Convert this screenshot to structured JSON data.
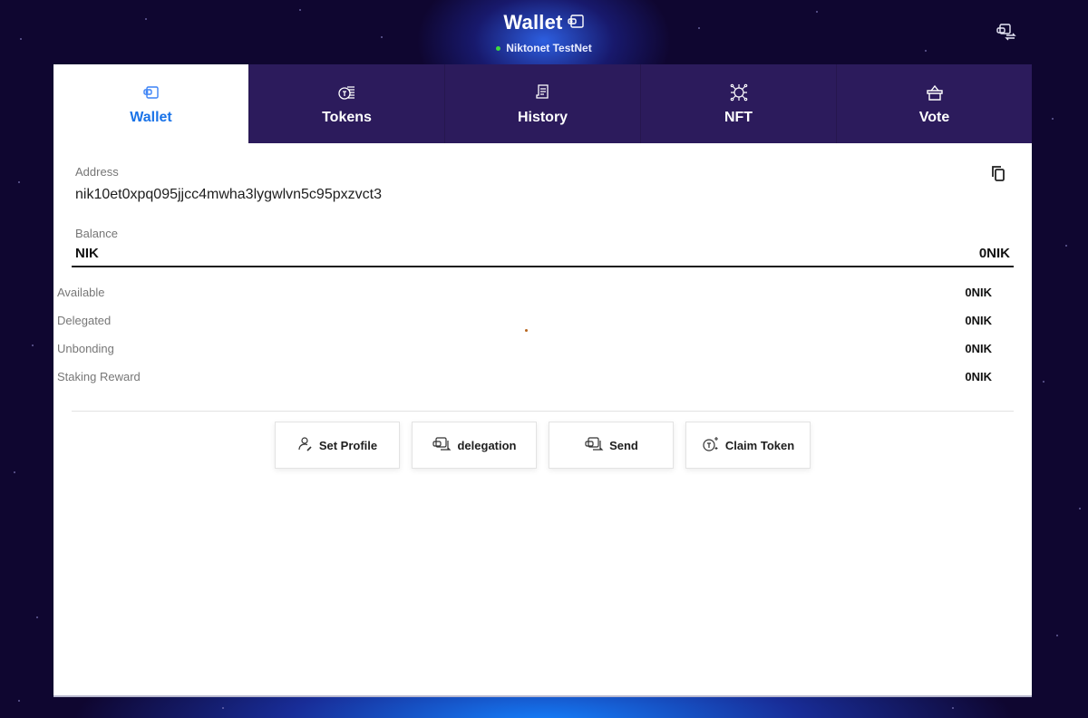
{
  "header": {
    "title": "Wallet",
    "title_icon": "wallet-icon",
    "network": "Niktonet TestNet",
    "network_status_color": "#3ddc3d",
    "switch_icon": "wallet-switch-icon"
  },
  "tabs": [
    {
      "label": "Wallet",
      "icon": "wallet-icon",
      "active": true
    },
    {
      "label": "Tokens",
      "icon": "tokens-icon",
      "active": false
    },
    {
      "label": "History",
      "icon": "history-icon",
      "active": false
    },
    {
      "label": "NFT",
      "icon": "nft-icon",
      "active": false
    },
    {
      "label": "Vote",
      "icon": "vote-icon",
      "active": false
    }
  ],
  "address": {
    "label": "Address",
    "value": "nik10et0xpq095jjcc4mwha3lygwlvn5c95pxzvct3",
    "copy_icon": "copy-icon"
  },
  "balance": {
    "label": "Balance",
    "token": "NIK",
    "amount": "0NIK"
  },
  "details": [
    {
      "label": "Available",
      "value": "0NIK"
    },
    {
      "label": "Delegated",
      "value": "0NIK"
    },
    {
      "label": "Unbonding",
      "value": "0NIK"
    },
    {
      "label": "Staking Reward",
      "value": "0NIK"
    }
  ],
  "actions": [
    {
      "label": "Set Profile",
      "icon": "user-edit-icon"
    },
    {
      "label": "delegation",
      "icon": "wallet-transfer-icon"
    },
    {
      "label": "Send",
      "icon": "wallet-send-icon"
    },
    {
      "label": "Claim Token",
      "icon": "token-sparkle-icon"
    }
  ],
  "colors": {
    "accent": "#1a73e8",
    "tab_bg": "#2c1b5c",
    "page_bg": "#0f0630"
  }
}
